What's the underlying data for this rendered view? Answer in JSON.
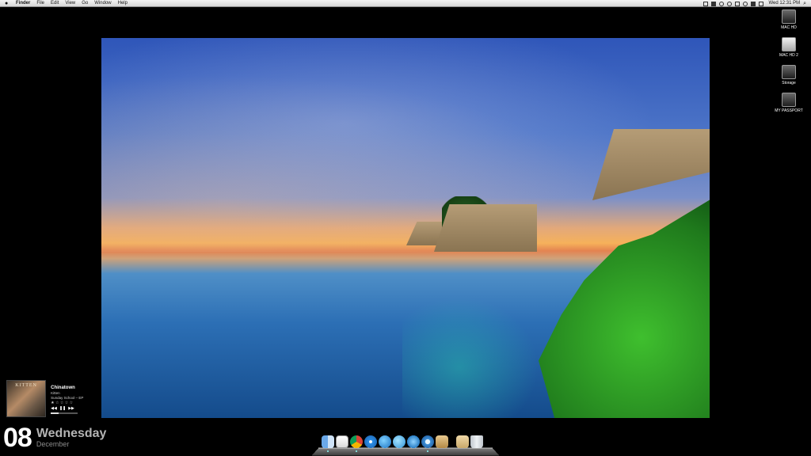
{
  "menubar": {
    "app_name": "Finder",
    "menus": [
      "File",
      "Edit",
      "View",
      "Go",
      "Window",
      "Help"
    ],
    "clock": "Wed 12:31 PM"
  },
  "desktop": {
    "drives": [
      {
        "label": "MAC HD",
        "icon": "hard-drive-icon"
      },
      {
        "label": "MAC HD 2",
        "icon": "hard-drive-icon"
      },
      {
        "label": "Storage",
        "icon": "hard-drive-icon"
      },
      {
        "label": "MY PASSPORT",
        "icon": "external-drive-icon"
      }
    ]
  },
  "now_playing": {
    "album_art_text": "KITTEN",
    "title": "Chinatown",
    "artist": "Kitten",
    "album": "Sunday School – EP",
    "rating_stars": 1,
    "rating_max": 5,
    "rating_glyphs": "★ ☆ ☆ ☆ ☆",
    "controls": [
      "previous",
      "pause",
      "next"
    ],
    "progress": 0.3
  },
  "date_widget": {
    "day": "08",
    "weekday": "Wednesday",
    "month": "December"
  },
  "dock": {
    "items": [
      "finder-icon",
      "mail-icon",
      "chrome-icon",
      "safari-icon",
      "globe-icon",
      "messenger-icon",
      "bird-icon",
      "itunes-icon",
      "package-icon",
      "folder-icon",
      "trash-icon"
    ]
  }
}
